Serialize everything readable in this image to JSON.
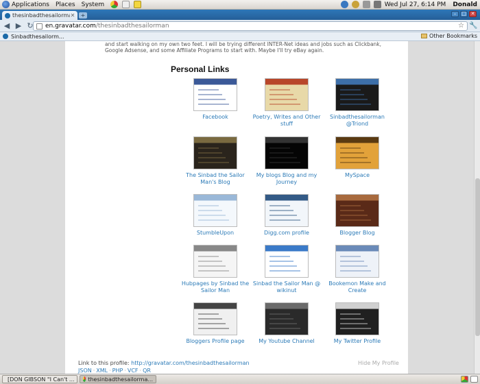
{
  "panel": {
    "menus": [
      "Applications",
      "Places",
      "System"
    ],
    "clock": "Wed Jul 27,  6:14 PM",
    "user": "Donald"
  },
  "browser": {
    "tab_title": "thesinbadthesailorma...",
    "url_host": "en.gravatar.com",
    "url_path": "/thesinbadthesailorman",
    "bookmark_item": "Sinbadthesailorm...",
    "other_bookmarks": "Other Bookmarks"
  },
  "page": {
    "intro_text": "and start walking on my own two feet. I will be trying different INTER-Net ideas and jobs such as Clickbank, Google Adsense, and some Affiliate Programs to start with. Maybe I'll try eBay again.",
    "section_title": "Personal Links",
    "links": [
      {
        "label": "Facebook",
        "colors": [
          "#ffffff",
          "#3b5998"
        ]
      },
      {
        "label": "Poetry, Writes and Other stuff",
        "colors": [
          "#e8d9a8",
          "#b8462a"
        ]
      },
      {
        "label": "Sinbadthesailorman @Triond",
        "colors": [
          "#1a1a1a",
          "#3d6fa8"
        ]
      },
      {
        "label": "The Sinbad the Sailor Man's Blog",
        "colors": [
          "#2a241c",
          "#7a6a40"
        ]
      },
      {
        "label": "My blogs Blog and my Journey",
        "colors": [
          "#050505",
          "#333333"
        ]
      },
      {
        "label": "MySpace",
        "colors": [
          "#e2a23a",
          "#5a3a12"
        ]
      },
      {
        "label": "StumbleUpon",
        "colors": [
          "#f4f8fc",
          "#9ab8d8"
        ]
      },
      {
        "label": "Digg.com profile",
        "colors": [
          "#f2f6fa",
          "#335a86"
        ]
      },
      {
        "label": "Blogger Blog",
        "colors": [
          "#5a2a18",
          "#a86a3e"
        ]
      },
      {
        "label": "Hubpages by Sinbad the Sailor Man",
        "colors": [
          "#f5f5f5",
          "#888888"
        ]
      },
      {
        "label": "Sinbad the Sailor Man @ wikinut",
        "colors": [
          "#ffffff",
          "#3a7ac8"
        ]
      },
      {
        "label": "Bookemon Make and Create",
        "colors": [
          "#eef2f8",
          "#6a8ab8"
        ]
      },
      {
        "label": "Bloggers Profile page",
        "colors": [
          "#f0f0f0",
          "#444444"
        ]
      },
      {
        "label": "My Youtube Channel",
        "colors": [
          "#2a2a2a",
          "#6a6a6a"
        ]
      },
      {
        "label": "My Twitter Profile",
        "colors": [
          "#202020",
          "#d0d0d0"
        ]
      }
    ],
    "footer_label": "Link to this profile:",
    "footer_url": "http://gravatar.com/thesinbadthesailorman",
    "hide_profile": "Hide My Profile",
    "formats": [
      "JSON",
      "XML",
      "PHP",
      "VCF",
      "QR"
    ]
  },
  "taskbar": {
    "tasks": [
      "[DON GIBSON \"I Can't ...",
      "thesinbadthesailorma..."
    ]
  }
}
